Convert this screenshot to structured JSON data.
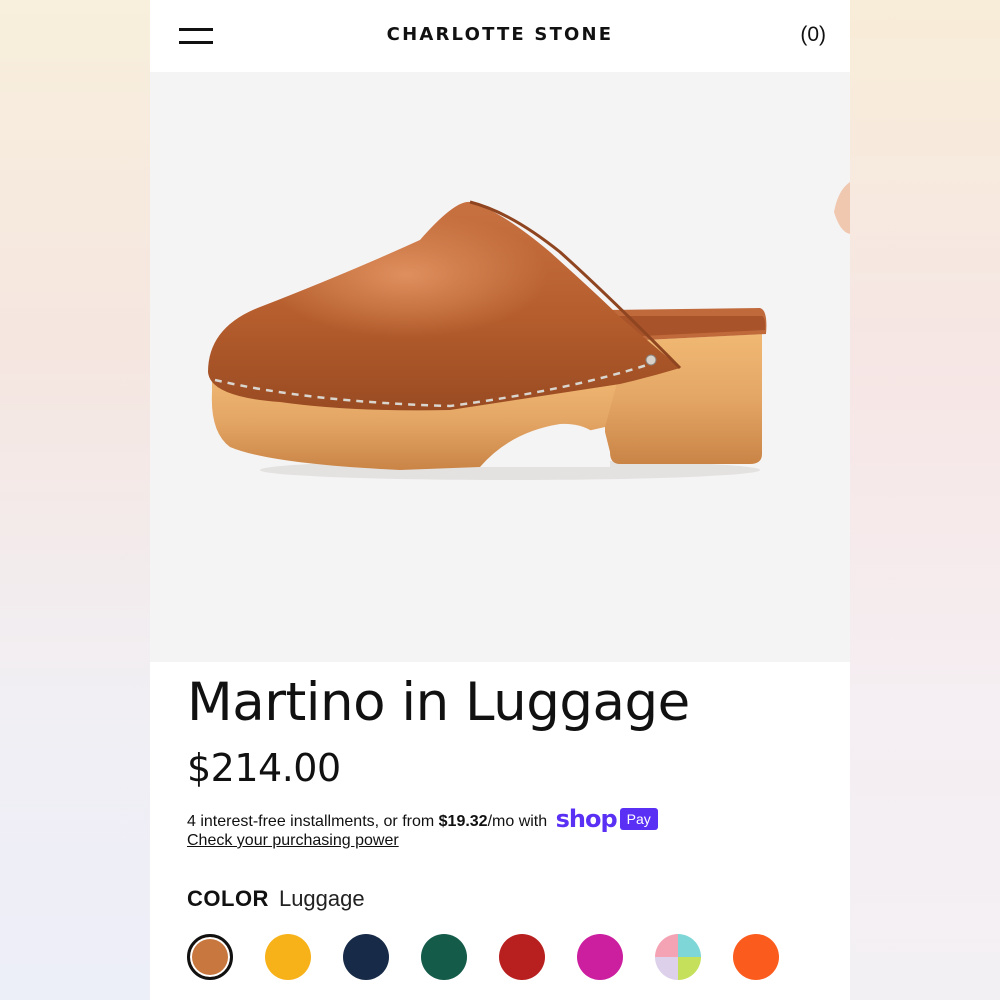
{
  "header": {
    "brand": "CHARLOTTE STONE",
    "cart_label": "(0)"
  },
  "product": {
    "title": "Martino in Luggage",
    "price": "$214.00",
    "installments_prefix": "4 interest-free installments, or from ",
    "installments_amount": "$19.32",
    "installments_suffix": "/mo with ",
    "shop_logo_text": "shop",
    "pay_badge_text": "Pay",
    "purchasing_power_link": "Check your purchasing power"
  },
  "color": {
    "label": "COLOR",
    "selected_value": "Luggage",
    "swatches": [
      {
        "color": "#c8773f",
        "selected": true
      },
      {
        "color": "#f7b21a",
        "selected": false
      },
      {
        "color": "#172a47",
        "selected": false
      },
      {
        "color": "#145b4a",
        "selected": false
      },
      {
        "color": "#b81f1f",
        "selected": false
      },
      {
        "color": "#cc1fa0",
        "selected": false
      },
      {
        "color": "multicolor",
        "selected": false
      },
      {
        "color": "#fb5c1e",
        "selected": false
      }
    ]
  },
  "colors": {
    "shop_pay_purple": "#5a31f4",
    "text": "#111111",
    "leather": "#b8602f",
    "wood": "#e4a665"
  }
}
